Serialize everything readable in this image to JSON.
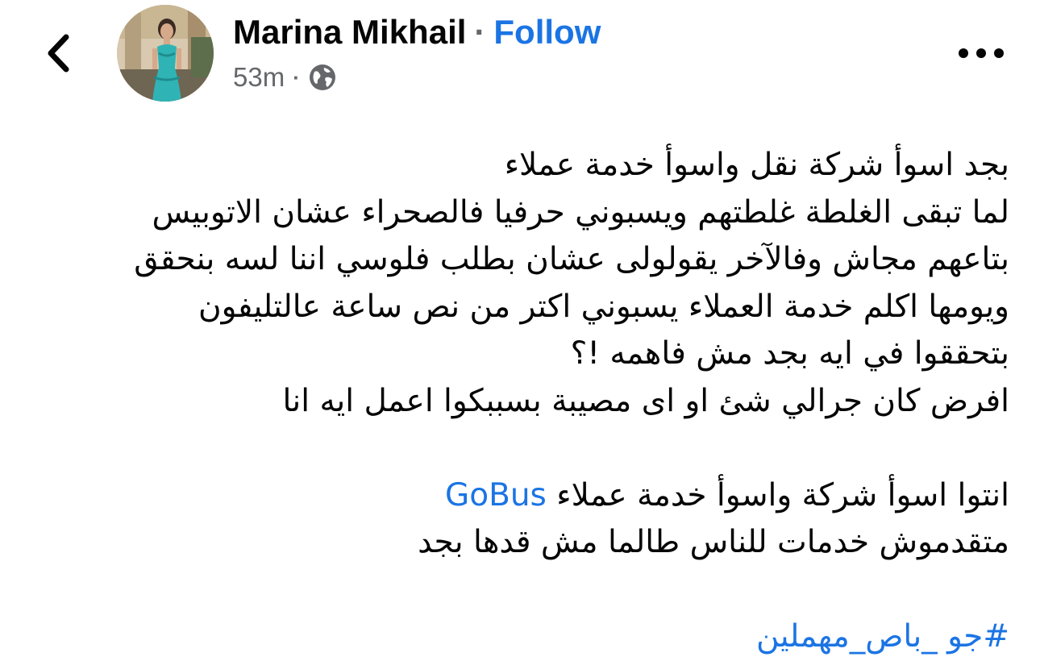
{
  "header": {
    "author_name": "Marina Mikhail",
    "separator": "·",
    "follow_label": "Follow",
    "timestamp": "53m",
    "meta_separator": "·",
    "privacy_icon": "globe-icon",
    "back_icon": "chevron-left-icon",
    "more_icon": "more-horizontal-icon"
  },
  "post": {
    "lines": [
      "بجد اسوأ شركة نقل واسوأ خدمة عملاء",
      "لما تبقى الغلطة غلطتهم ويسبوني حرفيا فالصحراء عشان الاتوبيس",
      "بتاعهم مجاش وفالآخر يقولولى عشان بطلب فلوسي اننا لسه بنحقق",
      "ويومها اكلم خدمة العملاء يسبوني اكتر من نص ساعة عالتليفون",
      "بتحققوا في ايه بجد مش فاهمه !؟",
      "افرض كان جرالي شئ او اى مصيبة بسببكوا اعمل ايه انا"
    ],
    "line7_text": "انتوا اسوأ شركة واسوأ خدمة عملاء ",
    "mention": "GoBus",
    "line8": "متقدموش خدمات للناس طالما مش قدها بجد",
    "hashtag": "#جو _باص_مهملين"
  },
  "colors": {
    "link": "#1b74e4",
    "text": "#050505",
    "secondary": "#65676b",
    "background": "#ffffff"
  }
}
